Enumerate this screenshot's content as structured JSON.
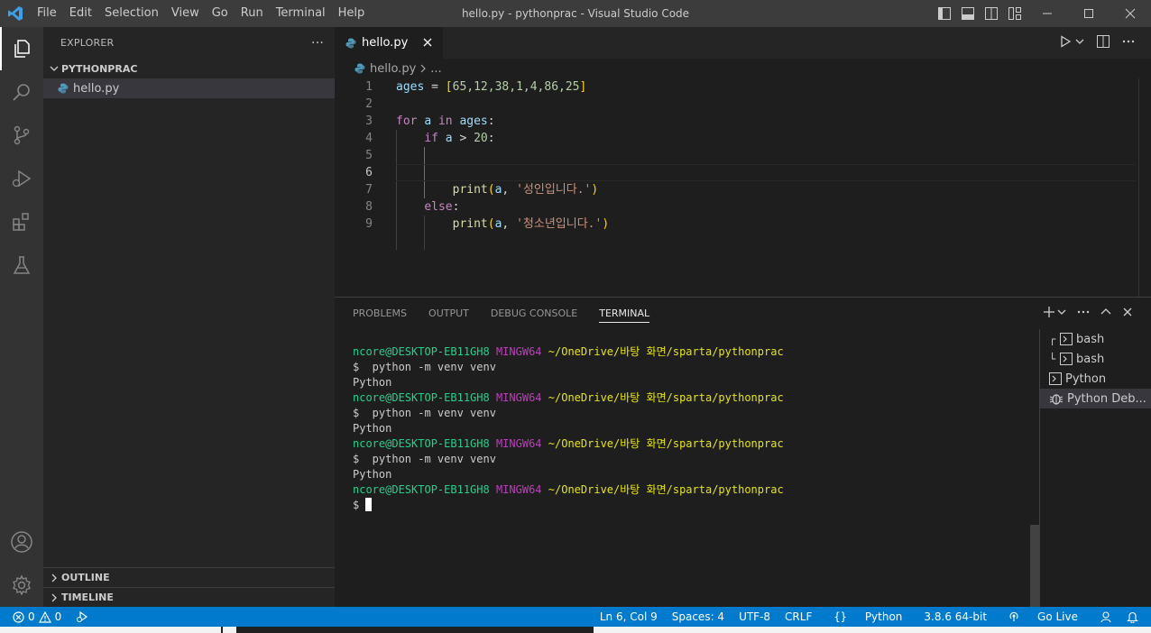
{
  "titlebar": {
    "menu": [
      "File",
      "Edit",
      "Selection",
      "View",
      "Go",
      "Run",
      "Terminal",
      "Help"
    ],
    "title": "hello.py - pythonprac - Visual Studio Code"
  },
  "sidebar": {
    "header": "EXPLORER",
    "more": "···",
    "folder": "PYTHONPRAC",
    "files": [
      "hello.py"
    ],
    "outline": "OUTLINE",
    "timeline": "TIMELINE"
  },
  "editor": {
    "tab": "hello.py",
    "breadcrumb_file": "hello.py",
    "breadcrumb_more": "...",
    "lines": [
      {
        "n": "1"
      },
      {
        "n": "2"
      },
      {
        "n": "3"
      },
      {
        "n": "4"
      },
      {
        "n": "5"
      },
      {
        "n": "6"
      },
      {
        "n": "7"
      },
      {
        "n": "8"
      },
      {
        "n": "9"
      }
    ],
    "code": {
      "l1_var": "ages",
      "l1_eq": " = ",
      "l1_open": "[",
      "l1_nums": "65,12,38,1,4,86,25",
      "l1_close": "]",
      "l3_for": "for",
      "l3_a": "a",
      "l3_in": "in",
      "l3_ages": "ages",
      "l3_colon": ":",
      "l4_if": "if",
      "l4_a": "a",
      "l4_op": " > ",
      "l4_num": "20",
      "l4_colon": ":",
      "l7_print": "print",
      "l7_open": "(",
      "l7_a": "a",
      "l7_comma": ", ",
      "l7_str": "'성인입니다.'",
      "l7_close": ")",
      "l8_else": "else",
      "l8_colon": ":",
      "l9_print": "print",
      "l9_open": "(",
      "l9_a": "a",
      "l9_comma": ", ",
      "l9_str": "'청소년입니다.'",
      "l9_close": ")"
    }
  },
  "panel": {
    "tabs": [
      "PROBLEMS",
      "OUTPUT",
      "DEBUG CONSOLE",
      "TERMINAL"
    ],
    "active_tab": "TERMINAL",
    "terminal": {
      "user": "ncore@DESKTOP-EB11GH8",
      "env": "MINGW64",
      "path": "~/OneDrive/바탕 화면/sparta/pythonprac",
      "cmd": "$  python -m venv venv",
      "out": "Python",
      "prompt": "$ "
    },
    "terminals": [
      "bash",
      "bash",
      "Python",
      "Python Deb..."
    ]
  },
  "statusbar": {
    "errors": "0",
    "warnings": "0",
    "position": "Ln 6, Col 9",
    "spaces": "Spaces: 4",
    "encoding": "UTF-8",
    "eol": "CRLF",
    "language": "Python",
    "interpreter": "3.8.6 64-bit",
    "golive": "Go Live"
  },
  "colors": {
    "accent": "#007acc",
    "titlebar": "#3c3c3c",
    "activitybar": "#333333",
    "sidebar": "#252526",
    "editor": "#1e1e1e"
  },
  "icons": [
    "vscode-logo-icon",
    "files-icon",
    "search-icon",
    "source-control-icon",
    "run-debug-icon",
    "extensions-icon",
    "testing-icon",
    "account-icon",
    "gear-icon"
  ]
}
